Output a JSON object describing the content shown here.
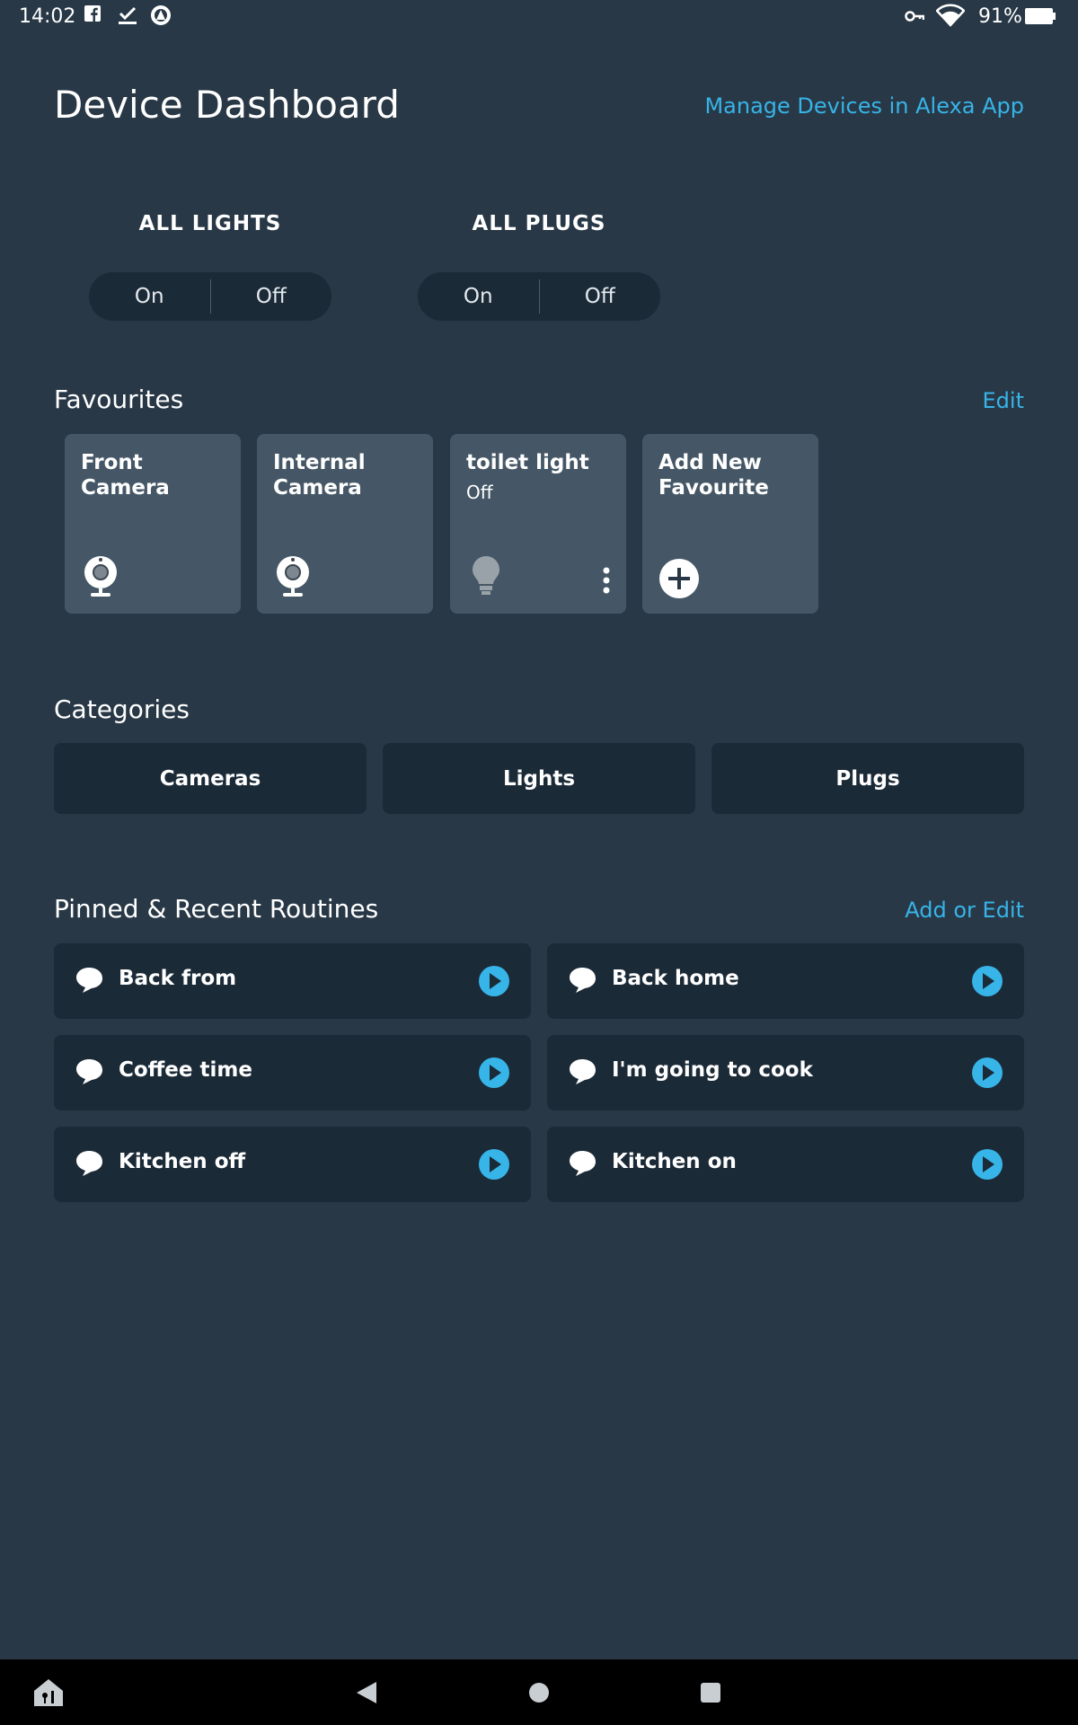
{
  "status_bar": {
    "time": "14:02",
    "battery": "91%",
    "icons": [
      "facebook-icon",
      "check-icon",
      "alexa-notification-icon",
      "vpn-key-icon",
      "wifi-icon",
      "battery-icon"
    ]
  },
  "header": {
    "title": "Device Dashboard",
    "manage_link": "Manage Devices in Alexa App"
  },
  "groups": [
    {
      "label": "ALL LIGHTS",
      "on": "On",
      "off": "Off"
    },
    {
      "label": "ALL PLUGS",
      "on": "On",
      "off": "Off"
    }
  ],
  "favourites": {
    "title": "Favourites",
    "action": "Edit",
    "cards": [
      {
        "name": "Front Camera",
        "status": "",
        "icon": "camera-icon"
      },
      {
        "name": "Internal Camera",
        "status": "",
        "icon": "camera-icon"
      },
      {
        "name": "toilet light",
        "status": "Off",
        "icon": "light-bulb-icon"
      },
      {
        "name": "Add New Favourite",
        "status": "",
        "icon": "plus-circle-icon"
      }
    ]
  },
  "categories": {
    "title": "Categories",
    "items": [
      "Cameras",
      "Lights",
      "Plugs"
    ]
  },
  "routines": {
    "title": "Pinned & Recent Routines",
    "action": "Add or Edit",
    "items": [
      "Back from",
      "Back home",
      "Coffee time",
      "I'm going to cook",
      "Kitchen off",
      "Kitchen on"
    ]
  },
  "colors": {
    "background": "#283846",
    "card": "#455766",
    "dark_tile": "#1b2a37",
    "accent": "#37b4e8",
    "nav_bar": "#000000"
  },
  "nav_bar": {
    "icons": [
      "home-device-icon",
      "back-icon",
      "home-icon",
      "recents-icon"
    ]
  }
}
